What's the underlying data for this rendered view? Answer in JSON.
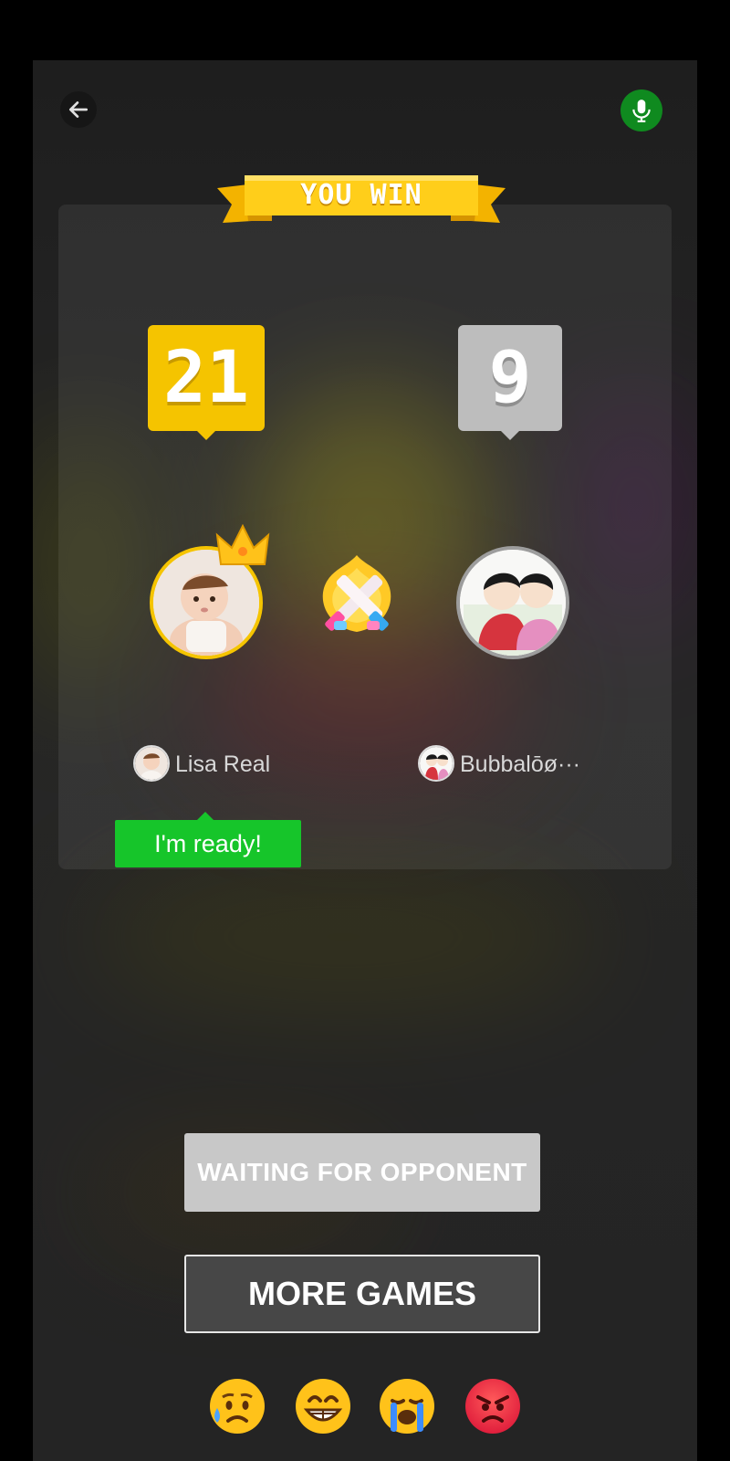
{
  "header": {
    "back_icon": "arrow-left-icon",
    "mic_icon": "microphone-icon",
    "mic_color": "#0f8a1f"
  },
  "result": {
    "banner": "YOU WIN"
  },
  "scores": {
    "player1": "21",
    "player2": "9"
  },
  "players": {
    "player1": {
      "name": "Lisa Real",
      "status": "I'm ready!"
    },
    "player2": {
      "name": "Bubbalōø···"
    }
  },
  "buttons": {
    "waiting": "WAITING FOR OPPONENT",
    "more_games": "MORE GAMES"
  },
  "reactions": [
    {
      "name": "sad-sweat-emoji"
    },
    {
      "name": "grinning-emoji"
    },
    {
      "name": "crying-emoji"
    },
    {
      "name": "angry-emoji"
    }
  ],
  "colors": {
    "win": "#f5c400",
    "lose": "#bdbdbd",
    "ready": "#16c52a"
  }
}
